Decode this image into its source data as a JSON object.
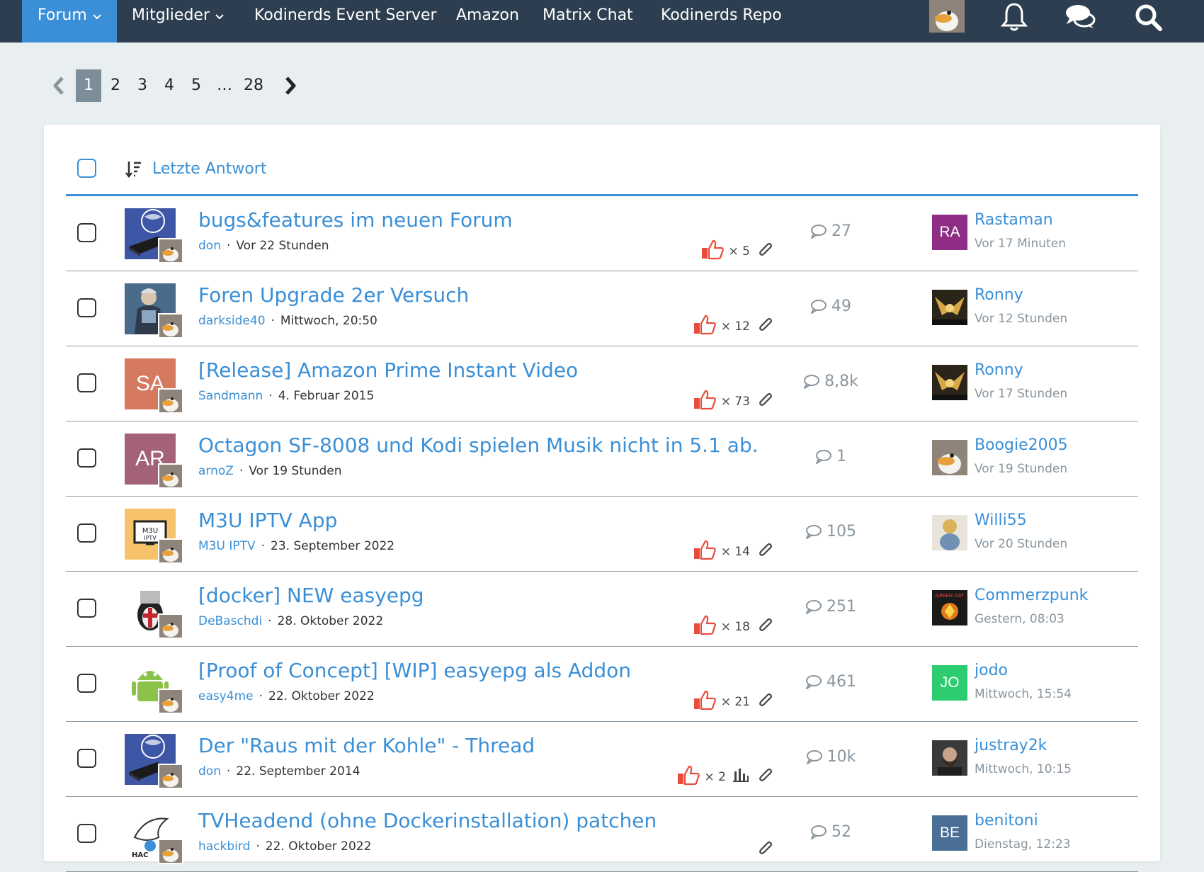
{
  "nav": {
    "items": [
      {
        "label": "Forum",
        "caret": true,
        "active": true
      },
      {
        "label": "Mitglieder",
        "caret": true,
        "active": false
      },
      {
        "label": "Kodinerds Event Server",
        "caret": false,
        "active": false
      },
      {
        "label": "Amazon",
        "caret": false,
        "active": false
      },
      {
        "label": "Matrix Chat",
        "caret": false,
        "active": false
      },
      {
        "label": "Kodinerds Repo",
        "caret": false,
        "active": false
      }
    ],
    "icons": [
      "user-avatar",
      "bell-icon",
      "chat-bubbles-icon",
      "search-icon"
    ]
  },
  "pagination": {
    "pages": [
      "1",
      "2",
      "3",
      "4",
      "5",
      "…",
      "28"
    ],
    "current": "1"
  },
  "list": {
    "sort_label": "Letzte Antwort",
    "threads": [
      {
        "title": "bugs&features im neuen Forum",
        "author": "don",
        "date": "Vor 22 Stunden",
        "likes": "× 5",
        "attachment": true,
        "poll": false,
        "replies": "27",
        "avatar": {
          "type": "picture",
          "icon": "kodinerds-box-picture"
        },
        "last_user": "Rastaman",
        "last_time": "Vor 17 Minuten",
        "last_avatar": {
          "type": "initials",
          "text": "RA",
          "color": "#8e2c86"
        }
      },
      {
        "title": "Foren Upgrade 2er Versuch",
        "author": "darkside40",
        "date": "Mittwoch, 20:50",
        "likes": "× 12",
        "attachment": true,
        "poll": false,
        "replies": "49",
        "avatar": {
          "type": "picture",
          "icon": "armored-figure-picture"
        },
        "last_user": "Ronny",
        "last_time": "Vor 12 Stunden",
        "last_avatar": {
          "type": "picture",
          "icon": "golden-eagle-picture"
        }
      },
      {
        "title": "[Release] Amazon Prime Instant Video",
        "author": "Sandmann",
        "date": "4. Februar 2015",
        "likes": "× 73",
        "attachment": true,
        "poll": false,
        "replies": "8,8k",
        "avatar": {
          "type": "initials",
          "text": "SA",
          "color": "#d57a60"
        },
        "last_user": "Ronny",
        "last_time": "Vor 17 Stunden",
        "last_avatar": {
          "type": "picture",
          "icon": "golden-eagle-picture"
        }
      },
      {
        "title": "Octagon SF-8008 und Kodi spielen Musik nicht in 5.1 ab.",
        "author": "arnoZ",
        "date": "Vor 19 Stunden",
        "likes": "",
        "attachment": false,
        "poll": false,
        "replies": "1",
        "avatar": {
          "type": "initials",
          "text": "AR",
          "color": "#a3627a"
        },
        "last_user": "Boogie2005",
        "last_time": "Vor 19 Stunden",
        "last_avatar": {
          "type": "picture",
          "icon": "duck-picture"
        }
      },
      {
        "title": "M3U IPTV App",
        "author": "M3U IPTV",
        "date": "23. September 2022",
        "likes": "× 14",
        "attachment": true,
        "poll": false,
        "replies": "105",
        "avatar": {
          "type": "picture",
          "icon": "m3u-iptv-picture"
        },
        "last_user": "Willi55",
        "last_time": "Vor 20 Stunden",
        "last_avatar": {
          "type": "picture",
          "icon": "cartoon-figure-picture"
        }
      },
      {
        "title": "[docker] NEW easyepg",
        "author": "DeBaschdi",
        "date": "28. Oktober 2022",
        "likes": "× 18",
        "attachment": true,
        "poll": false,
        "replies": "251",
        "avatar": {
          "type": "picture",
          "icon": "penguin-knight-picture"
        },
        "last_user": "Commerzpunk",
        "last_time": "Gestern, 08:03",
        "last_avatar": {
          "type": "picture",
          "icon": "album-cover-picture"
        }
      },
      {
        "title": "[Proof of Concept] [WIP] easyepg als Addon",
        "author": "easy4me",
        "date": "22. Oktober 2022",
        "likes": "× 21",
        "attachment": true,
        "poll": false,
        "replies": "461",
        "avatar": {
          "type": "picture",
          "icon": "android-robot-picture"
        },
        "last_user": "jodo",
        "last_time": "Mittwoch, 15:54",
        "last_avatar": {
          "type": "initials",
          "text": "JO",
          "color": "#2ecc71"
        }
      },
      {
        "title": "Der \"Raus mit der Kohle\" - Thread",
        "author": "don",
        "date": "22. September 2014",
        "likes": "× 2",
        "attachment": true,
        "poll": true,
        "replies": "10k",
        "avatar": {
          "type": "picture",
          "icon": "kodinerds-box-picture"
        },
        "last_user": "justray2k",
        "last_time": "Mittwoch, 10:15",
        "last_avatar": {
          "type": "picture",
          "icon": "bearded-man-picture"
        }
      },
      {
        "title": "TVHeadend (ohne Dockerinstallation) patchen",
        "author": "hackbird",
        "date": "22. Oktober 2022",
        "likes": "",
        "attachment": true,
        "poll": false,
        "replies": "52",
        "avatar": {
          "type": "picture",
          "icon": "hackbird-logo-picture"
        },
        "last_user": "benitoni",
        "last_time": "Dienstag, 12:23",
        "last_avatar": {
          "type": "initials",
          "text": "BE",
          "color": "#4a6f96"
        }
      }
    ]
  }
}
